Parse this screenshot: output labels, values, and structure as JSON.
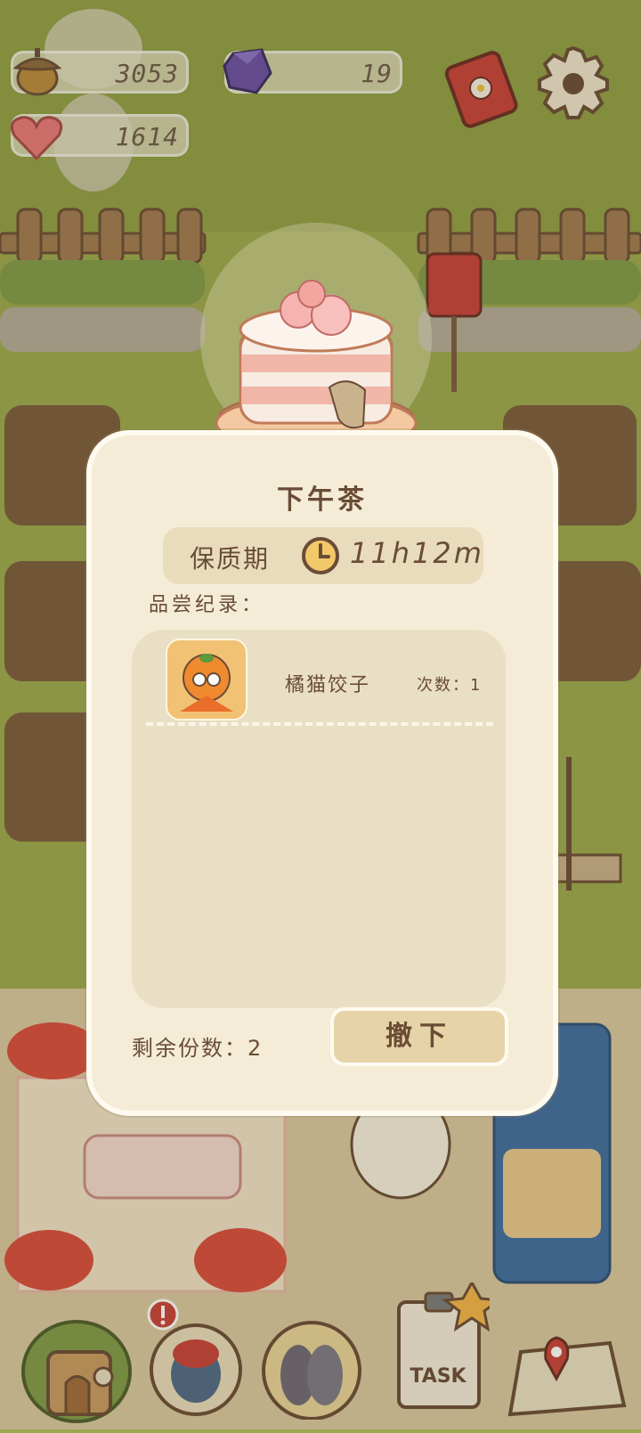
{
  "hud": {
    "acorns": "3053",
    "gems": "19",
    "hearts": "1614"
  },
  "dialog": {
    "title": "下午茶",
    "shelf_life_label": "保质期",
    "shelf_life_value": "11h12m",
    "records_label": "品尝纪录：",
    "records": [
      {
        "name": "橘猫饺子",
        "count_label": "次数：1"
      }
    ],
    "remaining_label": "剩余份数：2",
    "remove_button": "撤下"
  },
  "bottom_nav": {
    "task_label": "TASK"
  },
  "colors": {
    "grass": "#9aa94e",
    "panel": "#f4ecd6",
    "text": "#6a4c36",
    "button": "#e6d3a7"
  }
}
